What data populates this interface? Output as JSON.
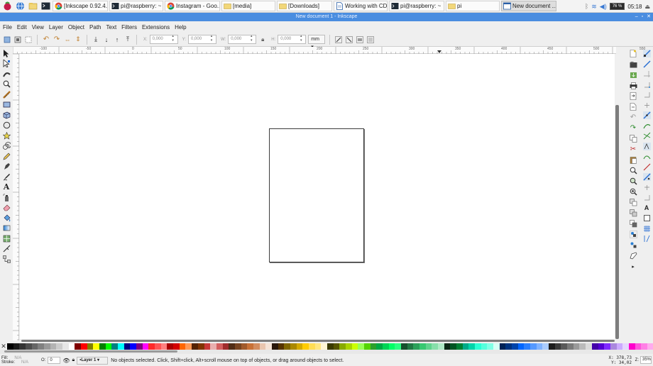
{
  "taskbar": {
    "tasks": [
      {
        "label": "[Inkscape 0.92.4...",
        "icon": "chrome-icon",
        "width": 78
      },
      {
        "label": "pi@raspberry: ~",
        "icon": "terminal-icon",
        "width": 76
      },
      {
        "label": "Instagram - Goo...",
        "icon": "chrome-icon",
        "width": 78
      },
      {
        "label": "[media]",
        "icon": "folder-icon",
        "width": 76
      },
      {
        "label": "[Downloads]",
        "icon": "folder-icon",
        "width": 78
      },
      {
        "label": "Working with CD...",
        "icon": "document-icon",
        "width": 76
      },
      {
        "label": "pi@raspberry: ~",
        "icon": "terminal-icon",
        "width": 78
      },
      {
        "label": "pi",
        "icon": "folder-icon",
        "width": 76
      },
      {
        "label": "New document ...",
        "icon": "inkscape-window-icon",
        "width": 78,
        "active": true
      }
    ],
    "cpu": "76 %",
    "clock": "05:18"
  },
  "window": {
    "title": "New document 1 - Inkscape",
    "controls": [
      "–",
      "▫",
      "✕"
    ]
  },
  "menu": [
    "File",
    "Edit",
    "View",
    "Layer",
    "Object",
    "Path",
    "Text",
    "Filters",
    "Extensions",
    "Help"
  ],
  "controls": {
    "x_label": "X:",
    "x_value": "0,000",
    "y_label": "Y:",
    "y_value": "0,000",
    "w_label": "W:",
    "w_value": "0,000",
    "h_label": "H:",
    "h_value": "0,000",
    "unit": "mm"
  },
  "ruler_labels": [
    "-100",
    "-50",
    "0",
    "50",
    "100",
    "150",
    "200",
    "250",
    "300",
    "350",
    "400",
    "450",
    "500",
    "550"
  ],
  "status": {
    "fill_label": "Fill:",
    "stroke_label": "Stroke:",
    "fill_value": "N/A",
    "stroke_value": "N/A",
    "opacity_label": "O:",
    "opacity_value": "0",
    "layer": "•Layer 1",
    "message": "No objects selected. Click, Shift+click, Alt+scroll mouse on top of objects, or drag around objects to select.",
    "x_coord": "X: 378,73",
    "y_coord": "Y:  34,02",
    "zoom_label": "Z:",
    "zoom_value": "35%"
  },
  "palette_colors": [
    "#000000",
    "#1a1a1a",
    "#333333",
    "#4d4d4d",
    "#666666",
    "#808080",
    "#999999",
    "#b3b3b3",
    "#cccccc",
    "#e6e6e6",
    "#ffffff",
    "#800000",
    "#ff0000",
    "#808000",
    "#ffff00",
    "#008000",
    "#00ff00",
    "#008080",
    "#00ffff",
    "#000080",
    "#0000ff",
    "#800080",
    "#ff00ff",
    "#ff2a2a",
    "#ff5555",
    "#ff8080",
    "#aa0000",
    "#d40000",
    "#ff6600",
    "#ff9955",
    "#552200",
    "#803300",
    "#c83737",
    "#e9afaf",
    "#d35f5f",
    "#a02c2c",
    "#502d16",
    "#784421",
    "#a05a2c",
    "#c87137",
    "#d38d5f",
    "#e9c6af",
    "#f4e3d7",
    "#28170b",
    "#553300",
    "#806600",
    "#aa8800",
    "#d4aa00",
    "#ffcc00",
    "#ffdd55",
    "#ffe680",
    "#fff6d5",
    "#3a3a00",
    "#555500",
    "#88aa00",
    "#aad400",
    "#ccff00",
    "#99ff55",
    "#55d400",
    "#2ca02c",
    "#00aa44",
    "#00d455",
    "#00ff66",
    "#2aff80",
    "#16502d",
    "#217844",
    "#2ca05a",
    "#37c871",
    "#5fd38d",
    "#87deaa",
    "#afe9c6",
    "#0b2816",
    "#005522",
    "#008033",
    "#00aa88",
    "#00d4aa",
    "#2affd5",
    "#55ffdd",
    "#80ffe6",
    "#d5fff6",
    "#002255",
    "#003380",
    "#0044aa",
    "#0066ff",
    "#2a7fff",
    "#5599ff",
    "#80b3ff",
    "#aaccff",
    "#1c1c1c",
    "#3a3a3a",
    "#5a5a5a",
    "#7a7a7a",
    "#9a9a9a",
    "#bababa",
    "#dadada",
    "#4400aa",
    "#5500d4",
    "#7f2aff",
    "#aa87de",
    "#ccaaff",
    "#e5d5ff",
    "#ff00cc",
    "#ff55dd",
    "#ff80e5",
    "#ffaaee"
  ]
}
